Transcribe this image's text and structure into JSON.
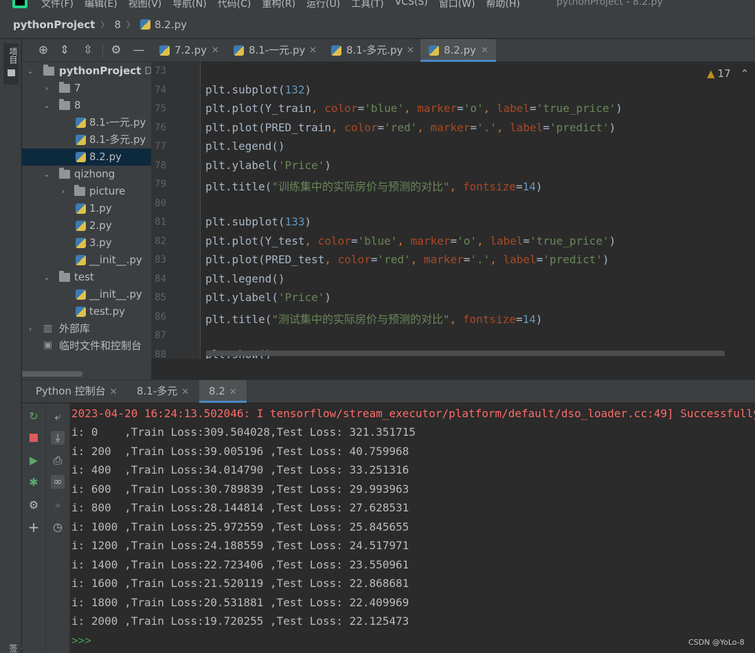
{
  "menu": {
    "items": [
      "文件(F)",
      "编辑(E)",
      "视图(V)",
      "导航(N)",
      "代码(C)",
      "重构(R)",
      "运行(U)",
      "工具(T)",
      "VCS(S)",
      "窗口(W)",
      "帮助(H)"
    ],
    "window_title": "pythonProject - 8.2.py"
  },
  "breadcrumb": {
    "root": "pythonProject",
    "folder": "8",
    "file": "8.2.py"
  },
  "left_strip": {
    "project_tab": "项目",
    "bookmarks_tab": "书签"
  },
  "tree": {
    "root": {
      "label": "pythonProject",
      "path": "D:\\"
    },
    "items": [
      {
        "label": "7"
      },
      {
        "label": "8"
      },
      {
        "label": "8.1-一元.py"
      },
      {
        "label": "8.1-多元.py"
      },
      {
        "label": "8.2.py"
      },
      {
        "label": "qizhong"
      },
      {
        "label": "picture"
      },
      {
        "label": "1.py"
      },
      {
        "label": "2.py"
      },
      {
        "label": "3.py"
      },
      {
        "label": "__init__.py"
      },
      {
        "label": "test"
      },
      {
        "label": "__init__.py"
      },
      {
        "label": "test.py"
      },
      {
        "label": "外部库"
      },
      {
        "label": "临时文件和控制台"
      }
    ]
  },
  "editor_tabs": [
    {
      "label": "7.2.py"
    },
    {
      "label": "8.1-一元.py"
    },
    {
      "label": "8.1-多元.py"
    },
    {
      "label": "8.2.py",
      "active": true
    }
  ],
  "editor": {
    "line_numbers": [
      "73",
      "74",
      "75",
      "76",
      "77",
      "78",
      "79",
      "80",
      "81",
      "82",
      "83",
      "84",
      "85",
      "86",
      "87",
      "88"
    ],
    "warning_count": "17",
    "code": {
      "l74": {
        "a": "plt.subplot(",
        "n": "132",
        "b": ")"
      },
      "l75": {
        "a": "plt.plot(Y_train",
        "c1": ", ",
        "p1": "color",
        "e1": "=",
        "s1": "'blue'",
        "c2": ", ",
        "p2": "marker",
        "e2": "=",
        "s2": "'o'",
        "c3": ", ",
        "p3": "label",
        "e3": "=",
        "s3": "'true_price'",
        "z": ")"
      },
      "l76": {
        "a": "plt.plot(PRED_train",
        "c1": ", ",
        "p1": "color",
        "e1": "=",
        "s1": "'red'",
        "c2": ", ",
        "p2": "marker",
        "e2": "=",
        "s2": "'.'",
        "c3": ", ",
        "p3": "label",
        "e3": "=",
        "s3": "'predict'",
        "z": ")"
      },
      "l77": "plt.legend()",
      "l78": {
        "a": "plt.ylabel(",
        "s": "'Price'",
        "b": ")"
      },
      "l79": {
        "a": "plt.title(",
        "s": "\"训练集中的实际房价与预测的对比\"",
        "c": ", ",
        "p": "fontsize",
        "e": "=",
        "n": "14",
        "b": ")"
      },
      "l81": {
        "a": "plt.subplot(",
        "n": "133",
        "b": ")"
      },
      "l82": {
        "a": "plt.plot(Y_test",
        "c1": ", ",
        "p1": "color",
        "e1": "=",
        "s1": "'blue'",
        "c2": ", ",
        "p2": "marker",
        "e2": "=",
        "s2": "'o'",
        "c3": ", ",
        "p3": "label",
        "e3": "=",
        "s3": "'true_price'",
        "z": ")"
      },
      "l83": {
        "a": "plt.plot(PRED_test",
        "c1": ", ",
        "p1": "color",
        "e1": "=",
        "s1": "'red'",
        "c2": ", ",
        "p2": "marker",
        "e2": "=",
        "s2": "'.'",
        "c3": ", ",
        "p3": "label",
        "e3": "=",
        "s3": "'predict'",
        "z": ")"
      },
      "l84": "plt.legend()",
      "l85": {
        "a": "plt.ylabel(",
        "s": "'Price'",
        "b": ")"
      },
      "l86": {
        "a": "plt.title(",
        "s": "\"测试集中的实际房价与预测的对比\"",
        "c": ", ",
        "p": "fontsize",
        "e": "=",
        "n": "14",
        "b": ")"
      },
      "l88": "plt.show()"
    }
  },
  "run_tabs": [
    {
      "label": "Python 控制台"
    },
    {
      "label": "8.1-多元"
    },
    {
      "label": "8.2",
      "active": true
    }
  ],
  "console": {
    "lines": [
      "2023-04-20 16:24:13.502046: I tensorflow/stream_executor/platform/default/dso_loader.cc:49] Successfully",
      "i: 0    ,Train Loss:309.504028,Test Loss: 321.351715",
      "i: 200  ,Train Loss:39.005196 ,Test Loss: 40.759968",
      "i: 400  ,Train Loss:34.014790 ,Test Loss: 33.251316",
      "i: 600  ,Train Loss:30.789839 ,Test Loss: 29.993963",
      "i: 800  ,Train Loss:28.144814 ,Test Loss: 27.628531",
      "i: 1000 ,Train Loss:25.972559 ,Test Loss: 25.845655",
      "i: 1200 ,Train Loss:24.188559 ,Test Loss: 24.517971",
      "i: 1400 ,Train Loss:22.723406 ,Test Loss: 23.550961",
      "i: 1600 ,Train Loss:21.520119 ,Test Loss: 22.868681",
      "i: 1800 ,Train Loss:20.531881 ,Test Loss: 22.409969",
      "i: 2000 ,Train Loss:19.720255 ,Test Loss: 22.125473"
    ],
    "prompt": ">>>",
    "watermark": "CSDN @YoLo-8"
  },
  "colors": {
    "error_text": "#ff6b68",
    "keyword": "#cc7832",
    "string": "#6a8759",
    "number": "#6897bb",
    "accent": "#4a88c7"
  }
}
